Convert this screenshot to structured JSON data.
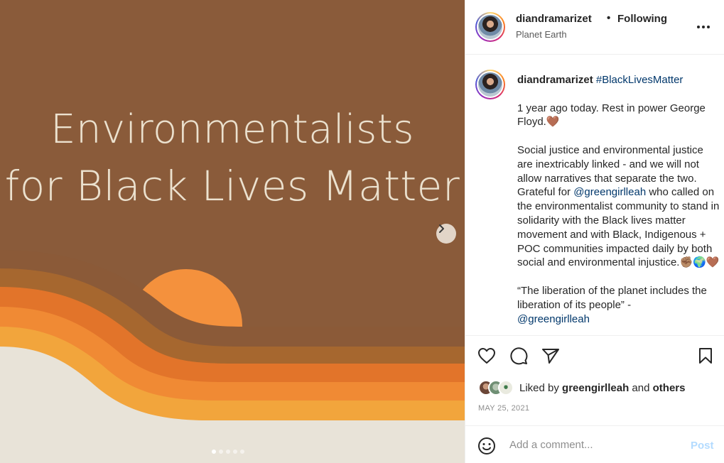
{
  "media": {
    "poster_line_1": "Environmentalists",
    "poster_line_2": "for Black Lives Matter",
    "next_icon": "chevron-right-icon",
    "carousel_count": 5,
    "carousel_active": 0,
    "colors": {
      "background": "#8a5b3a",
      "sun": "#f4913d",
      "stripes": [
        "#8b5a38",
        "#a5652f",
        "#e47a2a",
        "#f29538",
        "#f0a93c"
      ],
      "ground": "#e8e3d8",
      "text": "#ece2cf"
    }
  },
  "header": {
    "username": "diandramarizet",
    "separator": "•",
    "follow_status": "Following",
    "location": "Planet Earth",
    "more_icon": "more-horizontal-icon"
  },
  "caption": {
    "username": "diandramarizet",
    "hashtag": "#BlackLivesMatter",
    "p1": "1 year ago today. Rest in power George Floyd.🤎",
    "p2_before": "Social justice and environmental justice are inextricably linked - and we will not allow narratives that separate the two. Grateful for ",
    "p2_mention": "@greengirlleah",
    "p2_after": " who called on the environmentalist community to stand in solidarity with the Black lives matter movement and with Black, Indigenous + POC communities impacted daily by both social and environmental injustice.✊🏽🌍🤎",
    "p3": "“The liberation of the planet includes the liberation of its people” -",
    "p3_mention": "@greengirlleah"
  },
  "actions": {
    "like_icon": "heart-icon",
    "comment_icon": "comment-bubble-icon",
    "share_icon": "paper-plane-icon",
    "save_icon": "bookmark-icon"
  },
  "likes": {
    "prefix": "Liked by ",
    "user": "greengirlleah",
    "middle": " and ",
    "others": "others"
  },
  "date": "MAY 25, 2021",
  "comment": {
    "placeholder": "Add a comment...",
    "post_label": "Post",
    "emoji_icon": "smiley-face-icon"
  }
}
